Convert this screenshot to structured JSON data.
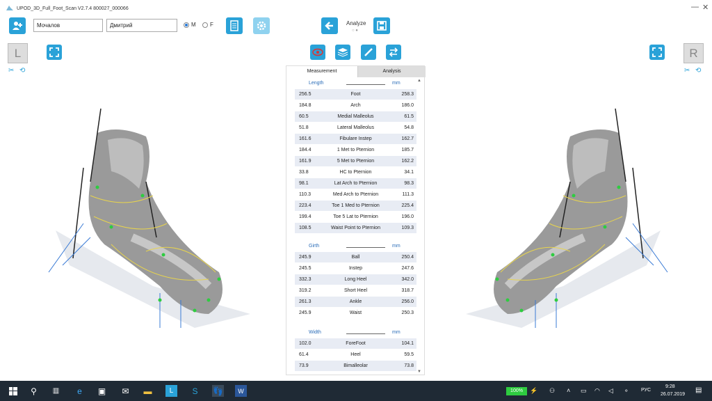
{
  "window": {
    "title": "UPOD_3D_Full_Foot_Scan V2.7.4    800027_000066",
    "minimize": "—",
    "close": "✕"
  },
  "toolbar": {
    "last_name": "Мочалов",
    "first_name": "Дмитрий",
    "gender_m": "M",
    "gender_f": "F",
    "analyze_label": "Analyze"
  },
  "view": {
    "left_label": "L",
    "right_label": "R"
  },
  "panel": {
    "tab_measurement": "Measurement",
    "tab_analysis": "Analysis",
    "sections": {
      "length": {
        "name": "Length",
        "unit": "mm",
        "rows": [
          [
            "256.5",
            "Foot",
            "258.3"
          ],
          [
            "184.8",
            "Arch",
            "186.0"
          ],
          [
            "60.5",
            "Medial Malleolus",
            "61.5"
          ],
          [
            "51.8",
            "Lateral Malleolus",
            "54.8"
          ],
          [
            "161.6",
            "Fibulare Instep",
            "162.7"
          ],
          [
            "184.4",
            "1 Met to Pternion",
            "185.7"
          ],
          [
            "161.9",
            "5 Met to Pternion",
            "162.2"
          ],
          [
            "33.8",
            "HC to Pternion",
            "34.1"
          ],
          [
            "98.1",
            "Lat Arch to Pternion",
            "98.3"
          ],
          [
            "110.3",
            "Med Arch to Pternion",
            "111.3"
          ],
          [
            "223.4",
            "Toe 1 Med to Pternion",
            "225.4"
          ],
          [
            "199.4",
            "Toe 5 Lat to Pternion",
            "196.0"
          ],
          [
            "108.5",
            "Waist Point to Pternion",
            "109.3"
          ]
        ]
      },
      "girth": {
        "name": "Girth",
        "unit": "mm",
        "rows": [
          [
            "245.9",
            "Ball",
            "250.4"
          ],
          [
            "245.5",
            "Instep",
            "247.6"
          ],
          [
            "332.3",
            "Long Heel",
            "342.0"
          ],
          [
            "319.2",
            "Short Heel",
            "318.7"
          ],
          [
            "261.3",
            "Ankle",
            "256.0"
          ],
          [
            "245.9",
            "Waist",
            "250.3"
          ]
        ]
      },
      "width": {
        "name": "Width",
        "unit": "mm",
        "rows": [
          [
            "102.0",
            "ForeFoot",
            "104.1"
          ],
          [
            "61.4",
            "Heel",
            "59.5"
          ],
          [
            "73.9",
            "Bimalleolar",
            "73.8"
          ]
        ]
      }
    }
  },
  "taskbar": {
    "battery": "100%",
    "language": "РУС",
    "time": "9:28",
    "date": "26.07.2019"
  },
  "colors": {
    "accent": "#2aa2d8",
    "taskbar": "#1f2a35",
    "row_alt": "#e8ecf4",
    "section_title": "#2a6cb8"
  }
}
